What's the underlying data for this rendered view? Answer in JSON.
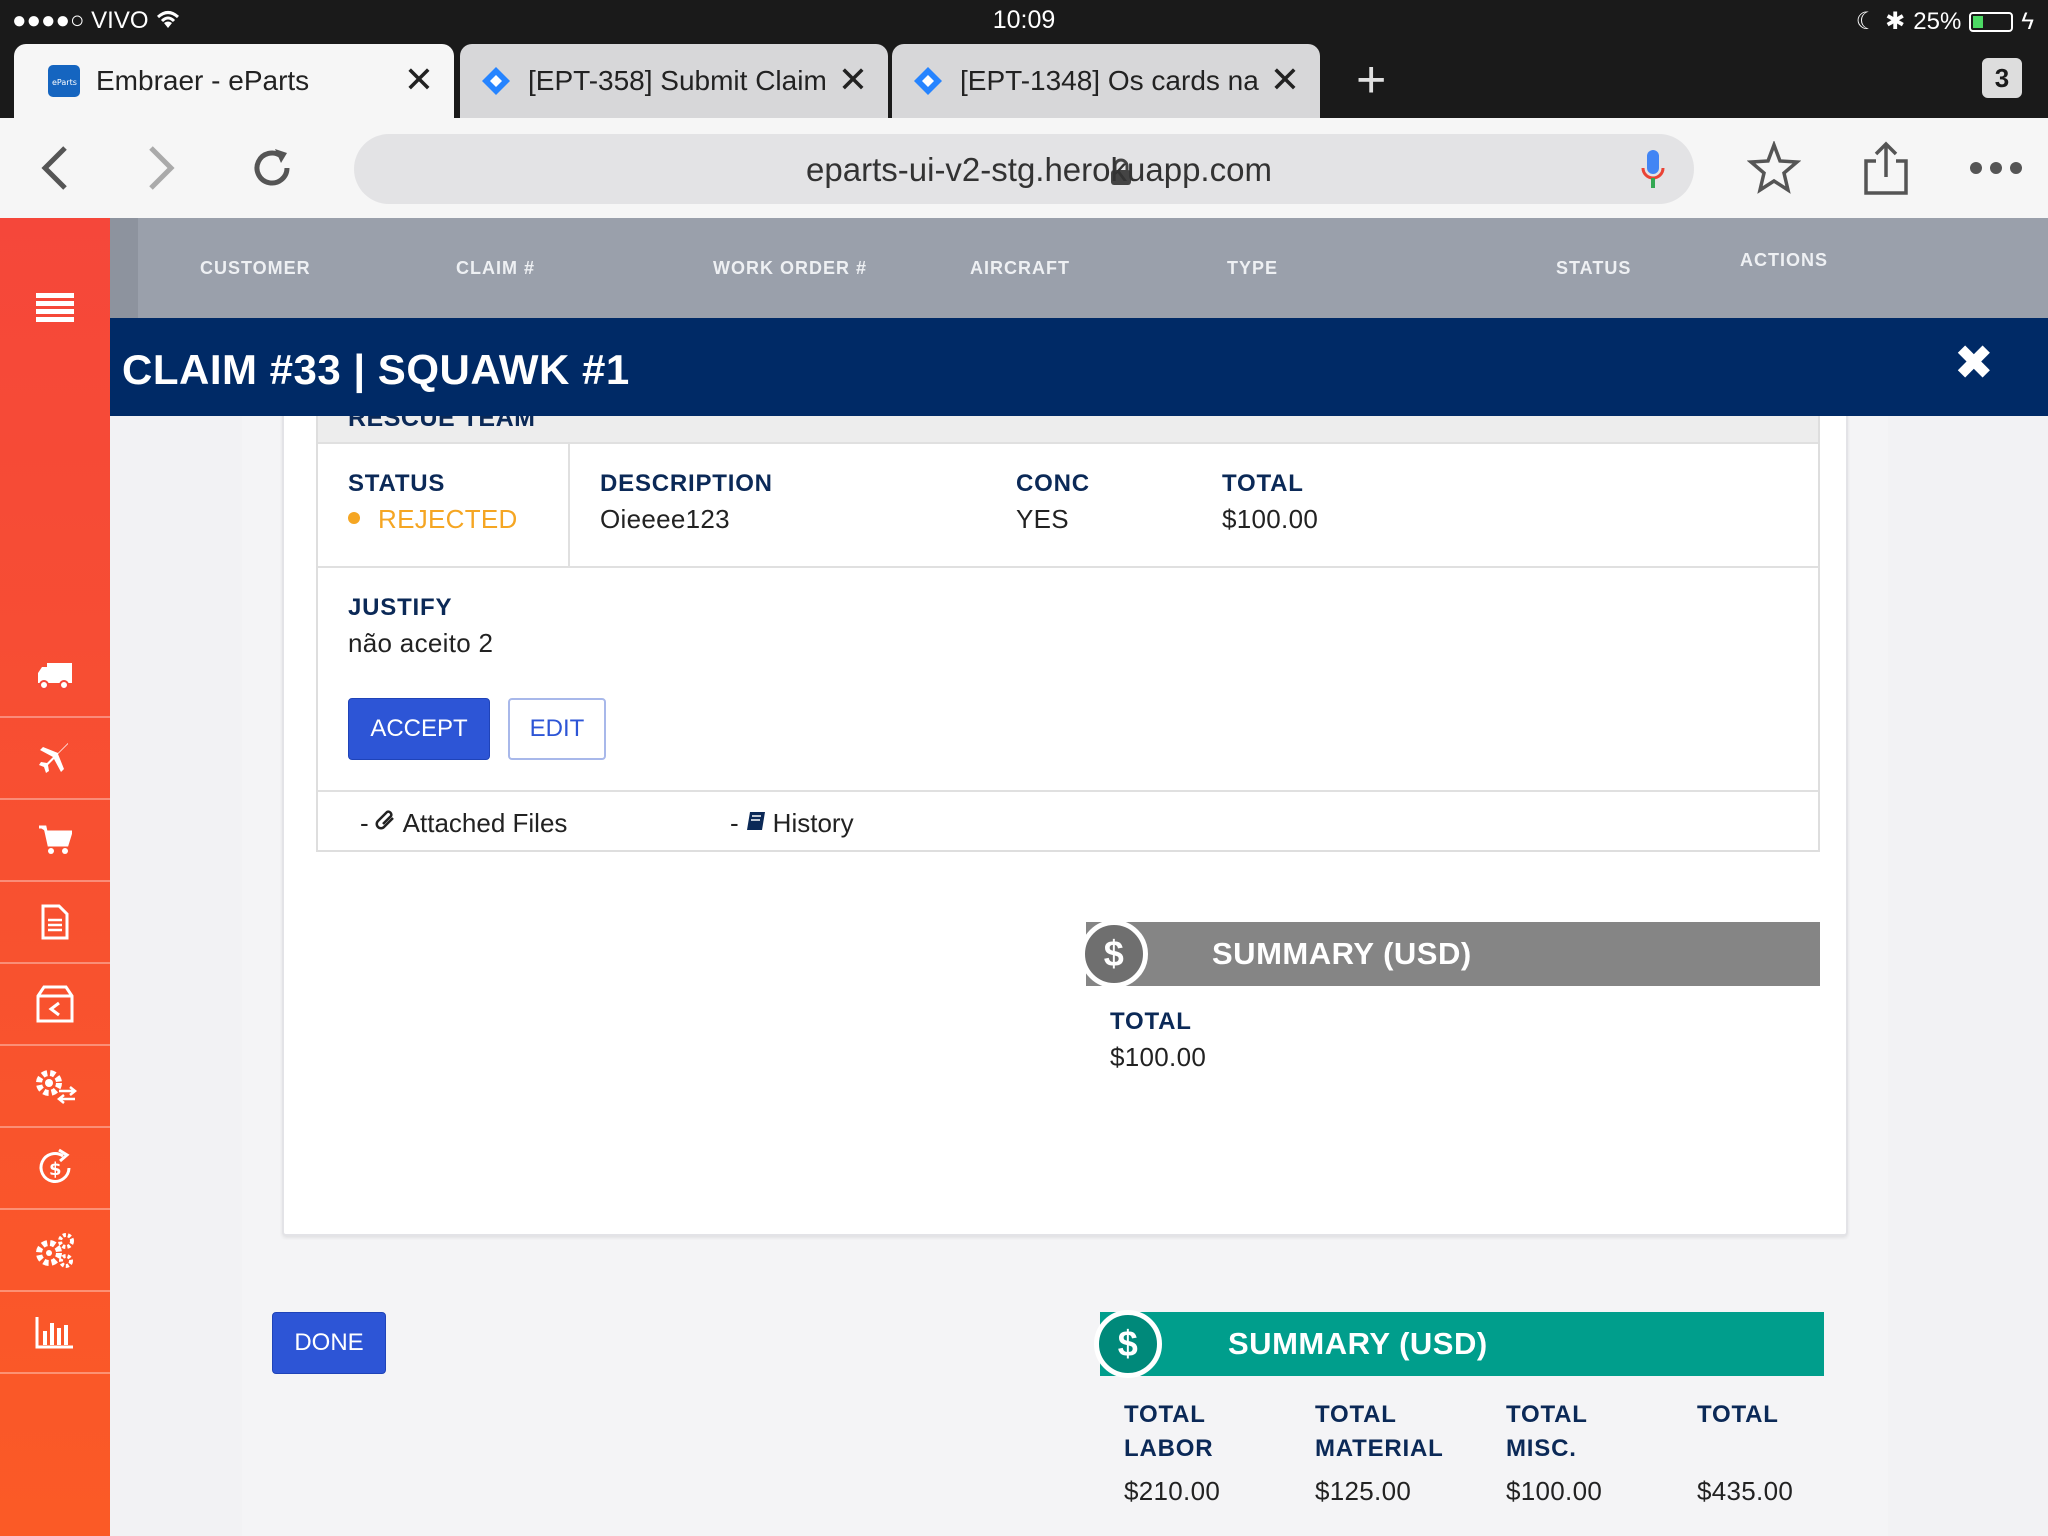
{
  "status_bar": {
    "carrier": "●●●●○ VIVO",
    "time": "10:09",
    "battery_percent": "25%",
    "battery_level": 0.25
  },
  "browser": {
    "tabs": [
      {
        "title": "Embraer - eParts",
        "favicon": "eparts-favicon",
        "active": true
      },
      {
        "title": "[EPT-358] Submit Claim",
        "favicon": "jira-icon",
        "active": false
      },
      {
        "title": "[EPT-1348] Os cards na",
        "favicon": "jira-icon",
        "active": false
      }
    ],
    "new_tab_label": "+",
    "tab_count": "3",
    "url": "eparts-ui-v2-stg.herokuapp.com"
  },
  "sidebar": {
    "items": [
      "truck-icon",
      "plane-icon",
      "cart-icon",
      "document-icon",
      "return-box-icon",
      "gear-exchange-icon",
      "refund-icon",
      "gears-icon",
      "bar-chart-icon"
    ]
  },
  "table_header": {
    "columns": [
      "CUSTOMER",
      "CLAIM #",
      "WORK ORDER #",
      "AIRCRAFT",
      "TYPE",
      "STATUS",
      "ACTIONS"
    ]
  },
  "modal": {
    "title": "CLAIM #33 | SQUAWK #1",
    "close_label": "✖",
    "squawk": {
      "section_label": "RESCUE TEAM",
      "status_label": "STATUS",
      "status_value": "REJECTED",
      "status_color": "#f5a623",
      "description_label": "DESCRIPTION",
      "description_value": "Oieeee123",
      "conc_label": "CONC",
      "conc_value": "YES",
      "total_label": "TOTAL",
      "total_value": "$100.00",
      "justify_label": "JUSTIFY",
      "justify_value": "não aceito 2",
      "accept_label": "ACCEPT",
      "edit_label": "EDIT",
      "attached_files_label": "Attached Files",
      "history_label": "History"
    },
    "squawk_summary": {
      "title": "SUMMARY (USD)",
      "badge": "$",
      "total_label": "TOTAL",
      "total_value": "$100.00",
      "color": "#858585"
    },
    "done_label": "DONE",
    "claim_summary": {
      "title": "SUMMARY (USD)",
      "badge": "$",
      "color": "#009e8c",
      "columns": [
        {
          "label_line1": "TOTAL",
          "label_line2": "LABOR",
          "value": "$210.00"
        },
        {
          "label_line1": "TOTAL",
          "label_line2": "MATERIAL",
          "value": "$125.00"
        },
        {
          "label_line1": "TOTAL",
          "label_line2": "MISC.",
          "value": "$100.00"
        },
        {
          "label_line1": "TOTAL",
          "label_line2": "",
          "value": "$435.00"
        }
      ]
    }
  }
}
